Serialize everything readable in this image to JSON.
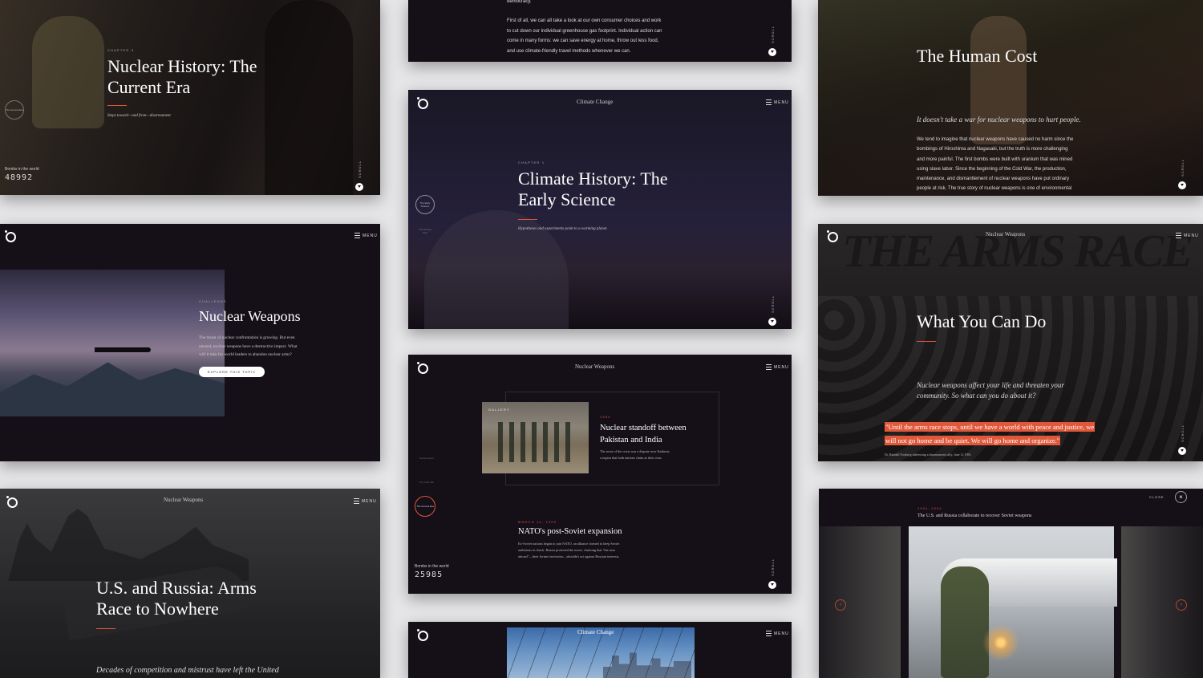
{
  "cards": {
    "nuclear_history": {
      "chapter": "CHAPTER 3",
      "title_line1": "Nuclear History: The",
      "title_line2": "Current Era",
      "subtitle": "Steps toward—and from—disarmament",
      "bombs_label": "Bombs in the world",
      "bombs_count": "48992",
      "nav_item": "The Current Era",
      "scroll_label": "SCROLL"
    },
    "top_middle": {
      "lead": "democracy.",
      "body": [
        "First of all, we can all take a look at our own consumer choices and work",
        "to cut down our individual greenhouse gas footprint. Individual action can",
        "come in many forms: we can save energy at home, throw out less food,",
        "and use climate-friendly travel methods whenever we can."
      ],
      "scroll_label": "SCROLL"
    },
    "human_cost": {
      "title": "The Human Cost",
      "subtitle": "It doesn't take a war for nuclear weapons to hurt people.",
      "body": [
        "We tend to imagine that nuclear weapons have caused no harm since the",
        "bombings of Hiroshima and Nagasaki, but the truth is more challenging",
        "and more painful. The first bombs were built with uranium that was mined",
        "using slave labor. Since the beginning of the Cold War, the production,",
        "maintenance, and dismantlement of nuclear weapons have put ordinary",
        "people at risk. The true story of nuclear weapons is one of environmental"
      ],
      "scroll_label": "SCROLL"
    },
    "climate_history": {
      "header": "Climate Change",
      "menu": "MENU",
      "chapter": "CHAPTER 1",
      "title_line1": "Climate History: The",
      "title_line2": "Early Science",
      "subtitle": "Hypotheses and experiments point to a warming planet.",
      "nav1": "The Early Science",
      "nav2": "The Hockey Stick",
      "scroll_label": "SCROLL"
    },
    "nuclear_weapons": {
      "menu": "MENU",
      "label": "CHALLENGE",
      "title": "Nuclear Weapons",
      "body": [
        "The threat of nuclear confrontation is growing. But even",
        "unused, nuclear weapons have a destructive impact. What",
        "will it take for world leaders to abandon nuclear arms?"
      ],
      "button": "EXPLORE THIS TOPIC"
    },
    "what_you_can_do": {
      "header": "Nuclear Weapons",
      "menu": "MENU",
      "title": "What You Can Do",
      "subtitle_line1": "Nuclear weapons affect your life and threaten your",
      "subtitle_line2": "community. So what can you do about it?",
      "quote_line1": "\"Until the arms race stops, until we have a world with peace and justice, we",
      "quote_line2": "will not go home and be quiet. We will go home and organize.\"",
      "attribution": "Dr. Randall Forsberg addressing a disarmament rally, June 12 1982",
      "banner": "THE ARMS RACE",
      "scroll_label": "SCROLL"
    },
    "nuclear_timeline": {
      "header": "Nuclear Weapons",
      "menu": "MENU",
      "gallery": "GALLERY",
      "year1": "1990",
      "title1_line1": "Nuclear standoff between",
      "title1_line2": "Pakistan and India",
      "body1_line1": "The roots of the crisis was a dispute over Kashmir,",
      "body1_line2": "a region that both nations claim as their own.",
      "date2": "MARCH 12, 1999",
      "title2": "NATO's post-Soviet expansion",
      "body2": [
        "Ex-Soviet nations began to join NATO, an alliance formed to keep Soviet",
        "ambitions in check. Russia protested the move, claiming that \"the near",
        "abroad\"—their former territories—shouldn't act against Russian interests."
      ],
      "nav1": "Nuclear Era II",
      "nav2": "The Cold War",
      "nav3": "The Current Era",
      "bombs_label": "Bombs in the world",
      "bombs_count": "25985",
      "scroll_label": "SCROLL"
    },
    "us_russia": {
      "header": "Nuclear Weapons",
      "menu": "MENU",
      "title_line1": "U.S. and Russia: Arms",
      "title_line2": "Race to Nowhere",
      "subtitle": "Decades of competition and mistrust have left the United"
    },
    "climate_bottom": {
      "header": "Climate Change",
      "menu": "MENU"
    },
    "gallery_detail": {
      "close": "CLOSE",
      "years": "1991–1994",
      "caption": "The U.S. and Russia collaborate to recover Soviet weapons"
    }
  },
  "colors": {
    "accent": "#e0573a",
    "card_bg": "#150f18",
    "page_bg": "#e6e6e8"
  }
}
